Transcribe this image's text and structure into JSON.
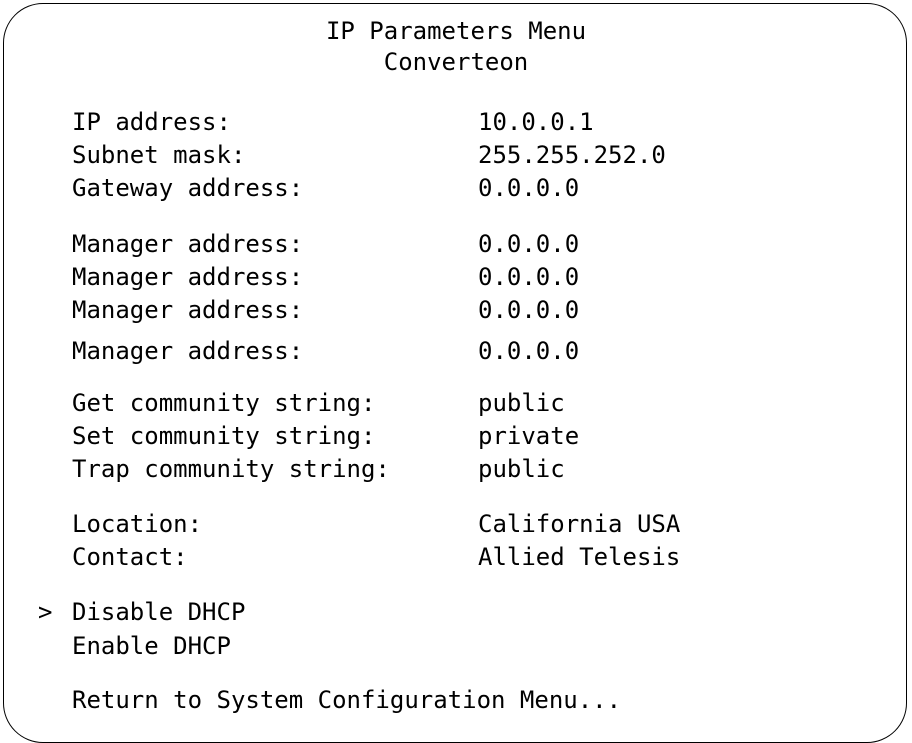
{
  "header": {
    "title": "IP Parameters Menu",
    "subtitle": "Converteon"
  },
  "network": [
    {
      "label": "IP address:",
      "value": "10.0.0.1"
    },
    {
      "label": "Subnet mask:",
      "value": "255.255.252.0"
    },
    {
      "label": "Gateway address:",
      "value": "0.0.0.0"
    }
  ],
  "managers": [
    {
      "label": "Manager address:",
      "value": "0.0.0.0"
    },
    {
      "label": "Manager address:",
      "value": "0.0.0.0"
    },
    {
      "label": "Manager address:",
      "value": "0.0.0.0"
    },
    {
      "label": "Manager address:",
      "value": "0.0.0.0"
    }
  ],
  "community": [
    {
      "label": "Get community string:",
      "value": "public"
    },
    {
      "label": "Set community string:",
      "value": "private"
    },
    {
      "label": "Trap community string:",
      "value": "public"
    }
  ],
  "info": [
    {
      "label": "Location:",
      "value": "California USA"
    },
    {
      "label": "Contact:",
      "value": "Allied Telesis"
    }
  ],
  "dhcp": {
    "cursor": ">",
    "options": [
      "Disable DHCP",
      "Enable DHCP"
    ]
  },
  "footer": {
    "return_label": "Return to System Configuration Menu..."
  }
}
